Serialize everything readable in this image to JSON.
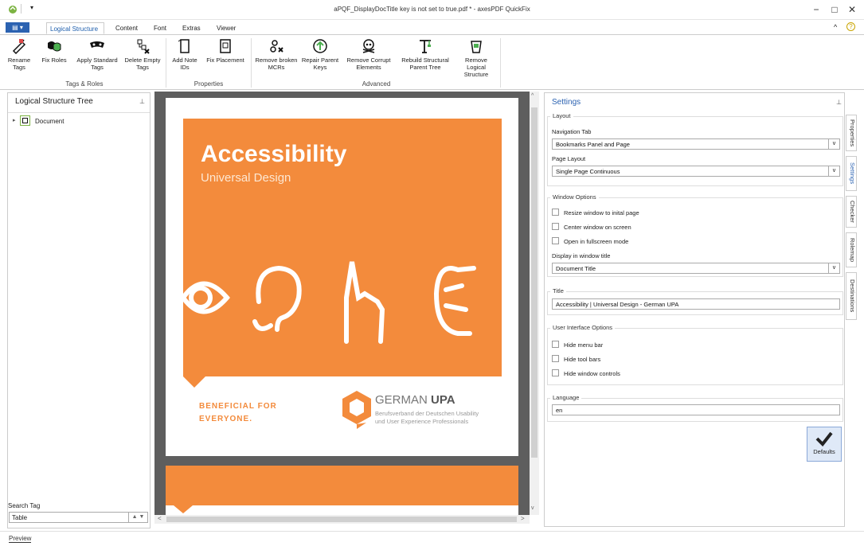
{
  "window": {
    "title": "aPQF_DisplayDocTitle key is not set to true.pdf * - axesPDF QuickFix"
  },
  "tabs": {
    "file": "▤ ▾",
    "logical": "Logical Structure",
    "content": "Content",
    "font": "Font",
    "extras": "Extras",
    "viewer": "Viewer"
  },
  "ribbon": {
    "rename": "Rename Tags",
    "fixroles": "Fix Roles",
    "apply": "Apply Standard Tags",
    "delete": "Delete Empty Tags",
    "group1": "Tags & Roles",
    "addnote": "Add Note IDs",
    "fixplacement": "Fix Placement",
    "group2": "Properties",
    "removebroken": "Remove broken MCRs",
    "repair": "Repair Parent Keys",
    "removecorrupt": "Remove Corrupt Elements",
    "rebuild": "Rebuild Structural Parent Tree",
    "removelogical": "Remove Logical Structure",
    "group3": "Advanced"
  },
  "left": {
    "title": "Logical Structure Tree",
    "tree_item": "Document",
    "search_label": "Search Tag",
    "search_value": "Table"
  },
  "doc": {
    "heading": "Accessibility",
    "subheading": "Universal Design",
    "beneficial1": "BENEFICIAL FOR",
    "beneficial2": "EVERYONE.",
    "org1": "GERMAN",
    "org2": "UPA",
    "orgline1": "Berufsverband der Deutschen Usability",
    "orgline2": "und User Experience Professionals"
  },
  "settings": {
    "title": "Settings",
    "layout": "Layout",
    "navtab_label": "Navigation Tab",
    "navtab_value": "Bookmarks Panel and Page",
    "pagelayout_label": "Page Layout",
    "pagelayout_value": "Single Page Continuous",
    "window_options": "Window Options",
    "resize": "Resize window to inital page",
    "center": "Center window on screen",
    "fullscreen": "Open in fullscreen mode",
    "display_label": "Display in window title",
    "display_value": "Document Title",
    "title_group": "Title",
    "title_value": "Accessibility | Universal Design - German UPA",
    "ui_options": "User Interface Options",
    "hidemenu": "Hide menu bar",
    "hidetool": "Hide tool bars",
    "hidewin": "Hide window controls",
    "language_group": "Language",
    "language_value": "en",
    "defaults": "Defaults"
  },
  "sidetabs": {
    "properties": "Properties",
    "settings": "Settings",
    "checker": "Checker",
    "rolemap": "Rolemap",
    "destinations": "Destinations"
  },
  "status": {
    "preview": "Preview"
  },
  "colors": {
    "orange": "#f38b3c",
    "accent": "#2b62b1"
  }
}
